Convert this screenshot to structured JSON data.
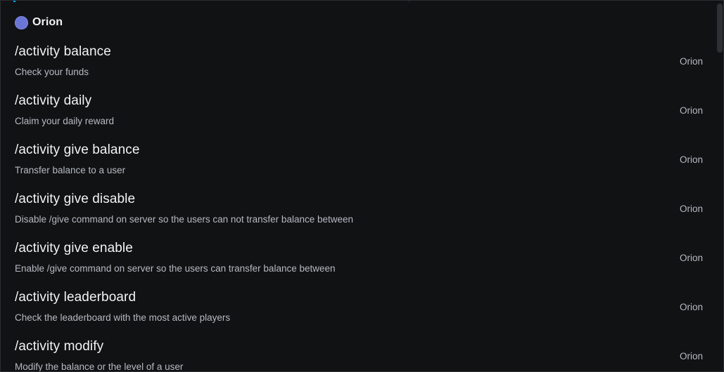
{
  "section": {
    "bot_name": "Orion",
    "avatar_color": "#6b75d6"
  },
  "commands": [
    {
      "name": "/activity balance",
      "description": "Check your funds",
      "source": "Orion"
    },
    {
      "name": "/activity daily",
      "description": "Claim your daily reward",
      "source": "Orion"
    },
    {
      "name": "/activity give balance",
      "description": "Transfer balance to a user",
      "source": "Orion"
    },
    {
      "name": "/activity give disable",
      "description": "Disable /give command on server so the users can not transfer balance between",
      "source": "Orion"
    },
    {
      "name": "/activity give enable",
      "description": "Enable /give command on server so the users can transfer balance between",
      "source": "Orion"
    },
    {
      "name": "/activity leaderboard",
      "description": "Check the leaderboard with the most active players",
      "source": "Orion"
    },
    {
      "name": "/activity modify",
      "description": "Modify the balance or the level of a user",
      "source": "Orion"
    }
  ]
}
